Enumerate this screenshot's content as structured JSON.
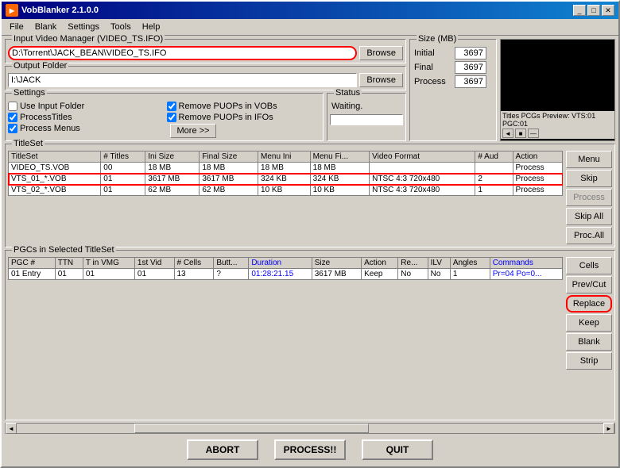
{
  "window": {
    "title": "VobBlanker 2.1.0.0",
    "icon": "dvd"
  },
  "menu": {
    "items": [
      "File",
      "Blank",
      "Settings",
      "Tools",
      "Help"
    ]
  },
  "input_video": {
    "label": "Input Video Manager (VIDEO_TS.IFO)",
    "value": "D:\\Torrent\\JACK_BEAN\\VIDEO_TS.IFO",
    "browse_label": "Browse"
  },
  "output_folder": {
    "label": "Output Folder",
    "value": "I:\\JACK",
    "browse_label": "Browse"
  },
  "size": {
    "label": "Size (MB)",
    "initial_label": "Initial",
    "initial_value": "3697",
    "final_label": "Final",
    "final_value": "3697",
    "process_label": "Process",
    "process_value": "3697"
  },
  "preview": {
    "label": "Titles PCGs Preview: VTS:01 PGC:01",
    "controls": [
      "◄",
      "■",
      "►"
    ]
  },
  "settings": {
    "label": "Settings",
    "checkboxes": [
      {
        "label": "Use Input Folder",
        "checked": false
      },
      {
        "label": "ProcessTitles",
        "checked": true
      },
      {
        "label": "Process Menus",
        "checked": true
      }
    ],
    "right_checkboxes": [
      {
        "label": "Remove PUOPs in VOBs",
        "checked": true
      },
      {
        "label": "Remove PUOPs in IFOs",
        "checked": true
      }
    ],
    "more_label": "More >>"
  },
  "status": {
    "label": "Status",
    "text": "Waiting.",
    "progress": 0
  },
  "titleset": {
    "label": "TitleSet",
    "columns": [
      "TitleSet",
      "# Titles",
      "Ini Size",
      "Final Size",
      "Menu Ini",
      "Menu Fi...",
      "Video Format",
      "# Aud",
      "Action"
    ],
    "rows": [
      {
        "name": "VIDEO_TS.VOB",
        "titles": "00",
        "ini_size": "18 MB",
        "final_size": "18 MB",
        "menu_ini": "18 MB",
        "menu_fi": "18 MB",
        "video_format": "",
        "aud": "",
        "action": "Process",
        "selected": false,
        "highlighted": false
      },
      {
        "name": "VTS_01_*.VOB",
        "titles": "01",
        "ini_size": "3617 MB",
        "final_size": "3617 MB",
        "menu_ini": "324 KB",
        "menu_fi": "324 KB",
        "video_format": "NTSC 4:3 720x480",
        "aud": "2",
        "action": "Process",
        "selected": false,
        "highlighted": true
      },
      {
        "name": "VTS_02_*.VOB",
        "titles": "01",
        "ini_size": "62 MB",
        "final_size": "62 MB",
        "menu_ini": "10 KB",
        "menu_fi": "10 KB",
        "video_format": "NTSC 4:3 720x480",
        "aud": "1",
        "action": "Process",
        "selected": false,
        "highlighted": false
      }
    ],
    "side_buttons": [
      "Menu",
      "Skip",
      "Process",
      "Skip All",
      "Proc.All"
    ]
  },
  "pgc": {
    "label": "PGCs in Selected TitleSet",
    "columns": [
      "PGC #",
      "TTN",
      "T in VMG",
      "1st Vid",
      "# Cells",
      "Butt...",
      "Duration",
      "Size",
      "Action",
      "Re...",
      "ILV",
      "Angles",
      "Commands"
    ],
    "rows": [
      {
        "pgc": "01 Entry",
        "ttn": "01",
        "t_in_vmg": "01",
        "first_vid": "01",
        "cells": "13",
        "butt": "?",
        "duration": "01:28:21.15",
        "size": "3617 MB",
        "action": "Keep",
        "re": "No",
        "ilv": "No",
        "angles": "1",
        "commands": "Pr=04 Po=0..."
      }
    ],
    "side_buttons": [
      "Cells",
      "Prev/Cut",
      "Replace",
      "Keep",
      "Blank",
      "Strip"
    ]
  },
  "scrollbar": {
    "position": 30
  },
  "footer": {
    "abort_label": "ABORT",
    "process_label": "PROCESS!!",
    "quit_label": "QUIT"
  }
}
